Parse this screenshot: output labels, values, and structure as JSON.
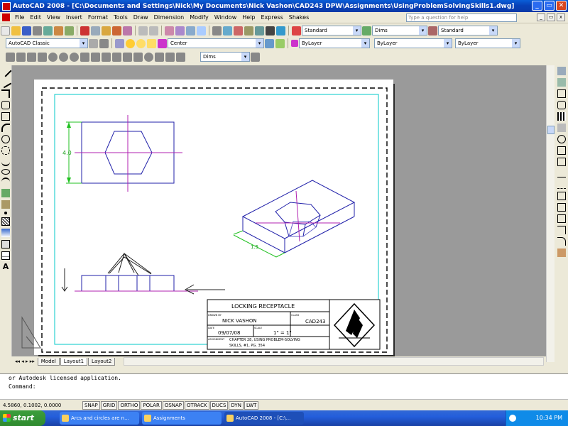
{
  "window": {
    "title": "AutoCAD 2008 - [C:\\Documents and Settings\\Nick\\My Documents\\Nick Vashon\\CAD243 DPW\\Assignments\\UsingProblemSolvingSkills1.dwg]",
    "minimize": "_",
    "restore": "▭",
    "close": "✕"
  },
  "menu": {
    "items": [
      "File",
      "Edit",
      "View",
      "Insert",
      "Format",
      "Tools",
      "Draw",
      "Dimension",
      "Modify",
      "Window",
      "Help",
      "Express",
      "Shakes"
    ],
    "help_placeholder": "Type a question for help"
  },
  "toolbars": {
    "text_style": "Standard",
    "dim_style": "Dims",
    "table_style": "Standard",
    "workspace": "AutoCAD Classic",
    "layer": "Center",
    "color": "ByLayer",
    "linetype": "ByLayer",
    "lineweight": "ByLayer",
    "dim_style2": "Dims"
  },
  "drawing": {
    "dim_label": "4.0",
    "dim_label_iso": "1.5",
    "title_block": {
      "title": "LOCKING RECEPTACLE",
      "drawn_by_label": "DRAWN BY",
      "drawn_by": "NICK VASHON",
      "class_label": "CLASS",
      "class": "CAD243",
      "date_label": "DATE",
      "date": "09/07/08",
      "scale_label": "SCALE",
      "scale": "1\" = 1\"",
      "assignment_label": "ASSIGNMENT",
      "assignment_line1": "CHAPTER 28, USING PROBLEM-SOLVING",
      "assignment_line2": "SKILLS, #1, PG. 354"
    }
  },
  "layout_tabs": [
    "Model",
    "Layout1",
    "Layout2"
  ],
  "command_line": {
    "history": "or Autodesk licensed application.",
    "prompt": "Command:"
  },
  "status_bar": {
    "coords": "4.5860, 0.1002, 0.0000",
    "toggles": [
      "SNAP",
      "GRID",
      "ORTHO",
      "POLAR",
      "OSNAP",
      "OTRACK",
      "DUCS",
      "DYN",
      "LWT"
    ]
  },
  "taskbar": {
    "start": "start",
    "tasks": [
      "Arcs and circles are n...",
      "Assignments",
      "AutoCAD 2008 - [C:\\..."
    ],
    "clock": "10:34 PM"
  }
}
